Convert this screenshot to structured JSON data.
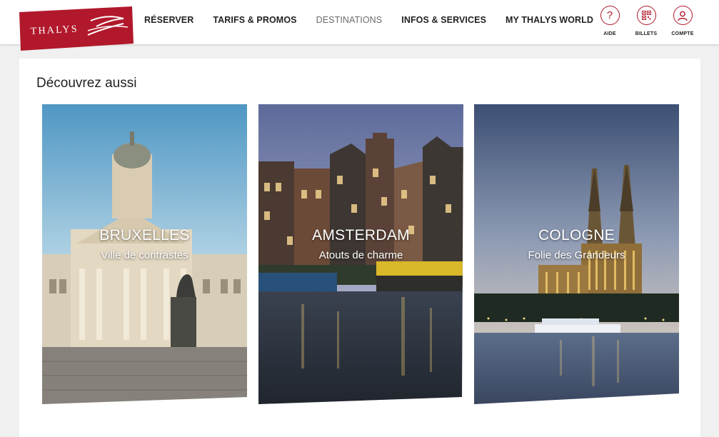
{
  "brand": {
    "name": "THALYS",
    "color": "#b1182b"
  },
  "nav": {
    "items": [
      {
        "label": "RÉSERVER"
      },
      {
        "label": "TARIFS & PROMOS"
      },
      {
        "label": "DESTINATIONS",
        "active": true
      },
      {
        "label": "INFOS & SERVICES"
      },
      {
        "label": "MY THALYS WORLD"
      }
    ]
  },
  "utility": {
    "aide": {
      "label": "AIDE",
      "icon": "question-icon"
    },
    "billets": {
      "label": "BILLETS",
      "icon": "qr-code-icon"
    },
    "compte": {
      "label": "COMPTE",
      "icon": "user-icon"
    }
  },
  "section": {
    "title": "Découvrez aussi",
    "destinations": [
      {
        "city": "BRUXELLES",
        "tagline": "Ville de contrastes"
      },
      {
        "city": "AMSTERDAM",
        "tagline": "Atouts de charme"
      },
      {
        "city": "COLOGNE",
        "tagline": "Folie des Grandeurs"
      }
    ]
  }
}
